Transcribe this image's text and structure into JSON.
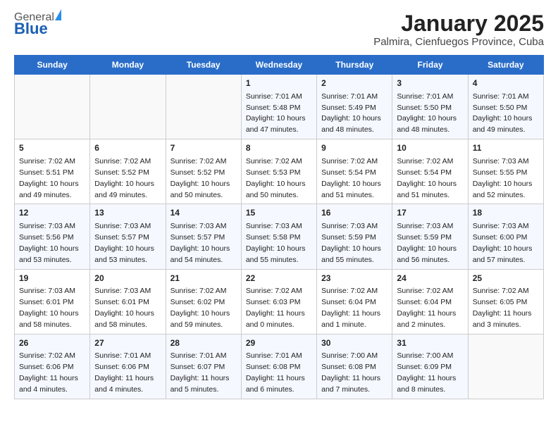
{
  "logo": {
    "general": "General",
    "blue": "Blue"
  },
  "header": {
    "title": "January 2025",
    "subtitle": "Palmira, Cienfuegos Province, Cuba"
  },
  "days_of_week": [
    "Sunday",
    "Monday",
    "Tuesday",
    "Wednesday",
    "Thursday",
    "Friday",
    "Saturday"
  ],
  "weeks": [
    [
      {
        "day": "",
        "info": ""
      },
      {
        "day": "",
        "info": ""
      },
      {
        "day": "",
        "info": ""
      },
      {
        "day": "1",
        "info": "Sunrise: 7:01 AM\nSunset: 5:48 PM\nDaylight: 10 hours and 47 minutes."
      },
      {
        "day": "2",
        "info": "Sunrise: 7:01 AM\nSunset: 5:49 PM\nDaylight: 10 hours and 48 minutes."
      },
      {
        "day": "3",
        "info": "Sunrise: 7:01 AM\nSunset: 5:50 PM\nDaylight: 10 hours and 48 minutes."
      },
      {
        "day": "4",
        "info": "Sunrise: 7:01 AM\nSunset: 5:50 PM\nDaylight: 10 hours and 49 minutes."
      }
    ],
    [
      {
        "day": "5",
        "info": "Sunrise: 7:02 AM\nSunset: 5:51 PM\nDaylight: 10 hours and 49 minutes."
      },
      {
        "day": "6",
        "info": "Sunrise: 7:02 AM\nSunset: 5:52 PM\nDaylight: 10 hours and 49 minutes."
      },
      {
        "day": "7",
        "info": "Sunrise: 7:02 AM\nSunset: 5:52 PM\nDaylight: 10 hours and 50 minutes."
      },
      {
        "day": "8",
        "info": "Sunrise: 7:02 AM\nSunset: 5:53 PM\nDaylight: 10 hours and 50 minutes."
      },
      {
        "day": "9",
        "info": "Sunrise: 7:02 AM\nSunset: 5:54 PM\nDaylight: 10 hours and 51 minutes."
      },
      {
        "day": "10",
        "info": "Sunrise: 7:02 AM\nSunset: 5:54 PM\nDaylight: 10 hours and 51 minutes."
      },
      {
        "day": "11",
        "info": "Sunrise: 7:03 AM\nSunset: 5:55 PM\nDaylight: 10 hours and 52 minutes."
      }
    ],
    [
      {
        "day": "12",
        "info": "Sunrise: 7:03 AM\nSunset: 5:56 PM\nDaylight: 10 hours and 53 minutes."
      },
      {
        "day": "13",
        "info": "Sunrise: 7:03 AM\nSunset: 5:57 PM\nDaylight: 10 hours and 53 minutes."
      },
      {
        "day": "14",
        "info": "Sunrise: 7:03 AM\nSunset: 5:57 PM\nDaylight: 10 hours and 54 minutes."
      },
      {
        "day": "15",
        "info": "Sunrise: 7:03 AM\nSunset: 5:58 PM\nDaylight: 10 hours and 55 minutes."
      },
      {
        "day": "16",
        "info": "Sunrise: 7:03 AM\nSunset: 5:59 PM\nDaylight: 10 hours and 55 minutes."
      },
      {
        "day": "17",
        "info": "Sunrise: 7:03 AM\nSunset: 5:59 PM\nDaylight: 10 hours and 56 minutes."
      },
      {
        "day": "18",
        "info": "Sunrise: 7:03 AM\nSunset: 6:00 PM\nDaylight: 10 hours and 57 minutes."
      }
    ],
    [
      {
        "day": "19",
        "info": "Sunrise: 7:03 AM\nSunset: 6:01 PM\nDaylight: 10 hours and 58 minutes."
      },
      {
        "day": "20",
        "info": "Sunrise: 7:03 AM\nSunset: 6:01 PM\nDaylight: 10 hours and 58 minutes."
      },
      {
        "day": "21",
        "info": "Sunrise: 7:02 AM\nSunset: 6:02 PM\nDaylight: 10 hours and 59 minutes."
      },
      {
        "day": "22",
        "info": "Sunrise: 7:02 AM\nSunset: 6:03 PM\nDaylight: 11 hours and 0 minutes."
      },
      {
        "day": "23",
        "info": "Sunrise: 7:02 AM\nSunset: 6:04 PM\nDaylight: 11 hours and 1 minute."
      },
      {
        "day": "24",
        "info": "Sunrise: 7:02 AM\nSunset: 6:04 PM\nDaylight: 11 hours and 2 minutes."
      },
      {
        "day": "25",
        "info": "Sunrise: 7:02 AM\nSunset: 6:05 PM\nDaylight: 11 hours and 3 minutes."
      }
    ],
    [
      {
        "day": "26",
        "info": "Sunrise: 7:02 AM\nSunset: 6:06 PM\nDaylight: 11 hours and 4 minutes."
      },
      {
        "day": "27",
        "info": "Sunrise: 7:01 AM\nSunset: 6:06 PM\nDaylight: 11 hours and 4 minutes."
      },
      {
        "day": "28",
        "info": "Sunrise: 7:01 AM\nSunset: 6:07 PM\nDaylight: 11 hours and 5 minutes."
      },
      {
        "day": "29",
        "info": "Sunrise: 7:01 AM\nSunset: 6:08 PM\nDaylight: 11 hours and 6 minutes."
      },
      {
        "day": "30",
        "info": "Sunrise: 7:00 AM\nSunset: 6:08 PM\nDaylight: 11 hours and 7 minutes."
      },
      {
        "day": "31",
        "info": "Sunrise: 7:00 AM\nSunset: 6:09 PM\nDaylight: 11 hours and 8 minutes."
      },
      {
        "day": "",
        "info": ""
      }
    ]
  ]
}
